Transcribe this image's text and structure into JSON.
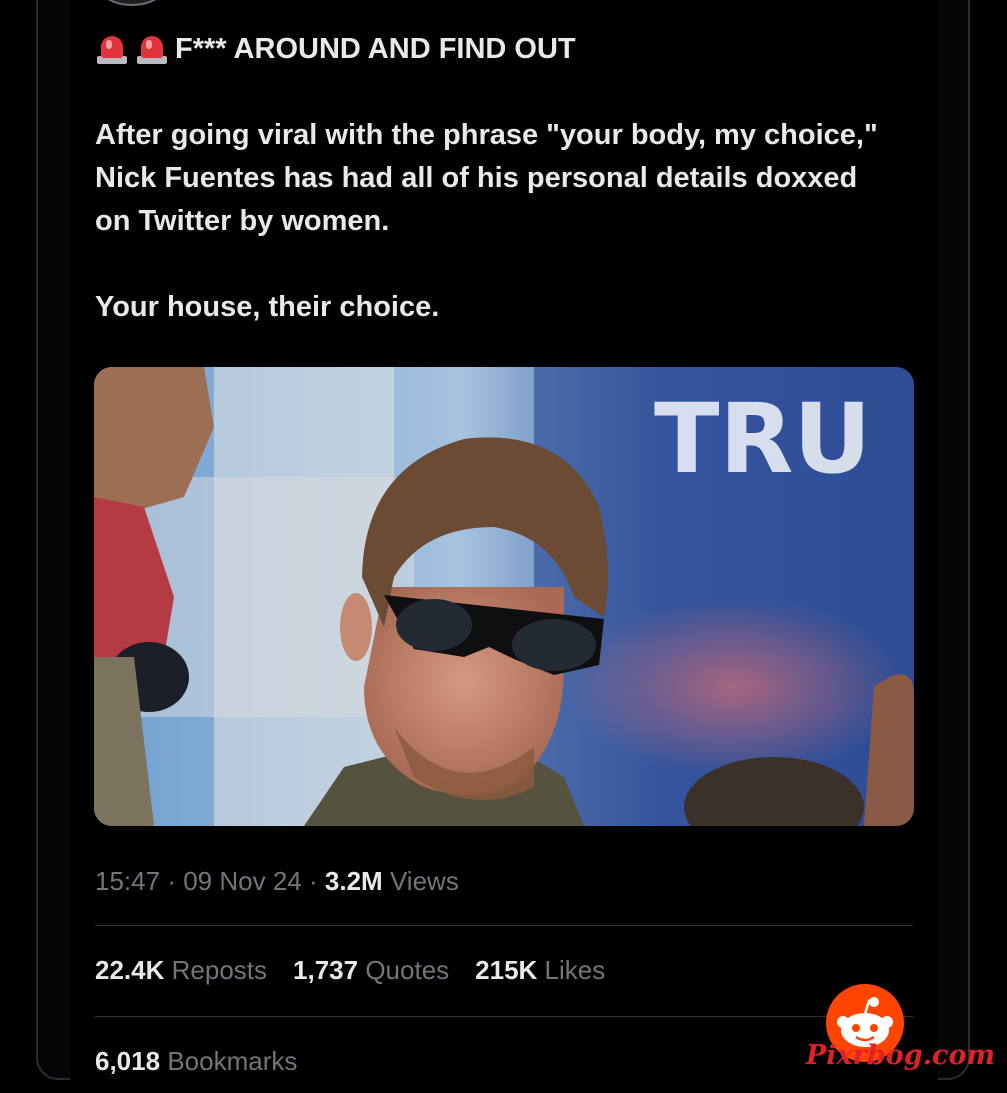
{
  "tweet": {
    "headline_emoji": "police-car-light-icon",
    "headline": "F*** AROUND AND FIND OUT",
    "body_paragraph_1": "After going viral with the phrase \"your body, my choice,\" Nick Fuentes has had all of his personal details doxxed on Twitter by women.",
    "body_paragraph_2": "Your house, their choice.",
    "image_flag_text": "TRU",
    "time": "15:47",
    "sep": "·",
    "date": "09 Nov 24",
    "views_count": "3.2M",
    "views_label": "Views",
    "stats": {
      "reposts_count": "22.4K",
      "reposts_label": "Reposts",
      "quotes_count": "1,737",
      "quotes_label": "Quotes",
      "likes_count": "215K",
      "likes_label": "Likes"
    },
    "bookmarks_count": "6,018",
    "bookmarks_label": "Bookmarks"
  },
  "watermark": {
    "text": "Pixrbog.com",
    "logo": "reddit-alien-icon"
  },
  "colors": {
    "background": "#000000",
    "text_primary": "#e7e9ea",
    "text_secondary": "#71767b",
    "divider": "#2f3336",
    "watermark_red": "#e0202a",
    "reddit_orange": "#ff4500"
  }
}
